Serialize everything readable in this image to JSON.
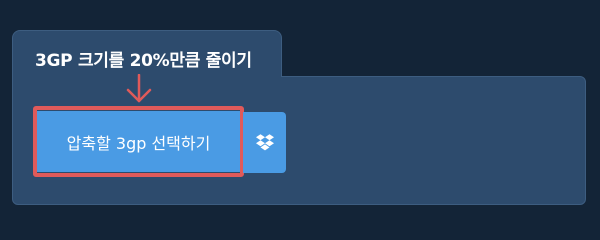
{
  "header": {
    "title": "3GP 크기를 20%만큼 줄이기"
  },
  "upload": {
    "select_label": "압축할 3gp 선택하기",
    "dropbox_icon": "dropbox-icon"
  },
  "colors": {
    "page_background": "#132437",
    "panel_background": "#2d4b6d",
    "button_blue": "#4a9be4",
    "highlight_red": "#e05a5a"
  }
}
